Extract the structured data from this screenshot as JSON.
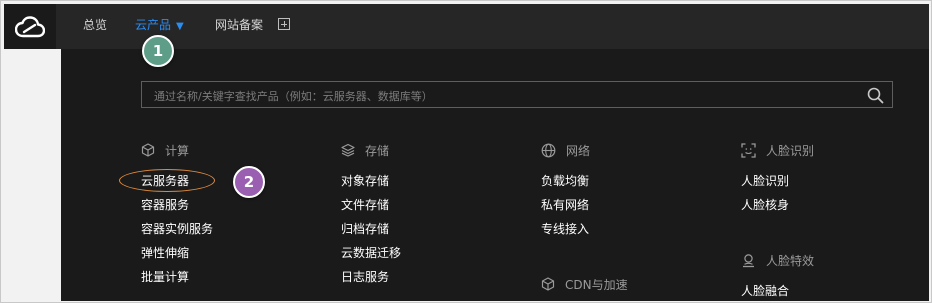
{
  "topbar": {
    "nav": {
      "overview": "总览",
      "products": "云产品",
      "filing": "网站备案"
    }
  },
  "search": {
    "placeholder": "通过名称/关键字查找产品（例如：云服务器、数据库等）"
  },
  "categories": {
    "compute": {
      "title": "计算",
      "items": [
        "云服务器",
        "容器服务",
        "容器实例服务",
        "弹性伸缩",
        "批量计算"
      ]
    },
    "storage": {
      "title": "存储",
      "items": [
        "对象存储",
        "文件存储",
        "归档存储",
        "云数据迁移",
        "日志服务"
      ]
    },
    "network": {
      "title": "网络",
      "items": [
        "负载均衡",
        "私有网络",
        "专线接入"
      ]
    },
    "cdn": {
      "title": "CDN与加速"
    },
    "face_recognition": {
      "title": "人脸识别",
      "items": [
        "人脸识别",
        "人脸核身"
      ]
    },
    "face_effects": {
      "title": "人脸特效",
      "items": [
        "人脸融合"
      ]
    }
  },
  "annotations": {
    "step1": "1",
    "step2": "2"
  },
  "colors": {
    "topbar_bg": "#262626",
    "panel_bg": "#1a1a1a",
    "active_nav": "#2b8cf2",
    "badge1": "#5e9e88",
    "badge2": "#9a5fb0",
    "highlight": "#e08a3c"
  }
}
